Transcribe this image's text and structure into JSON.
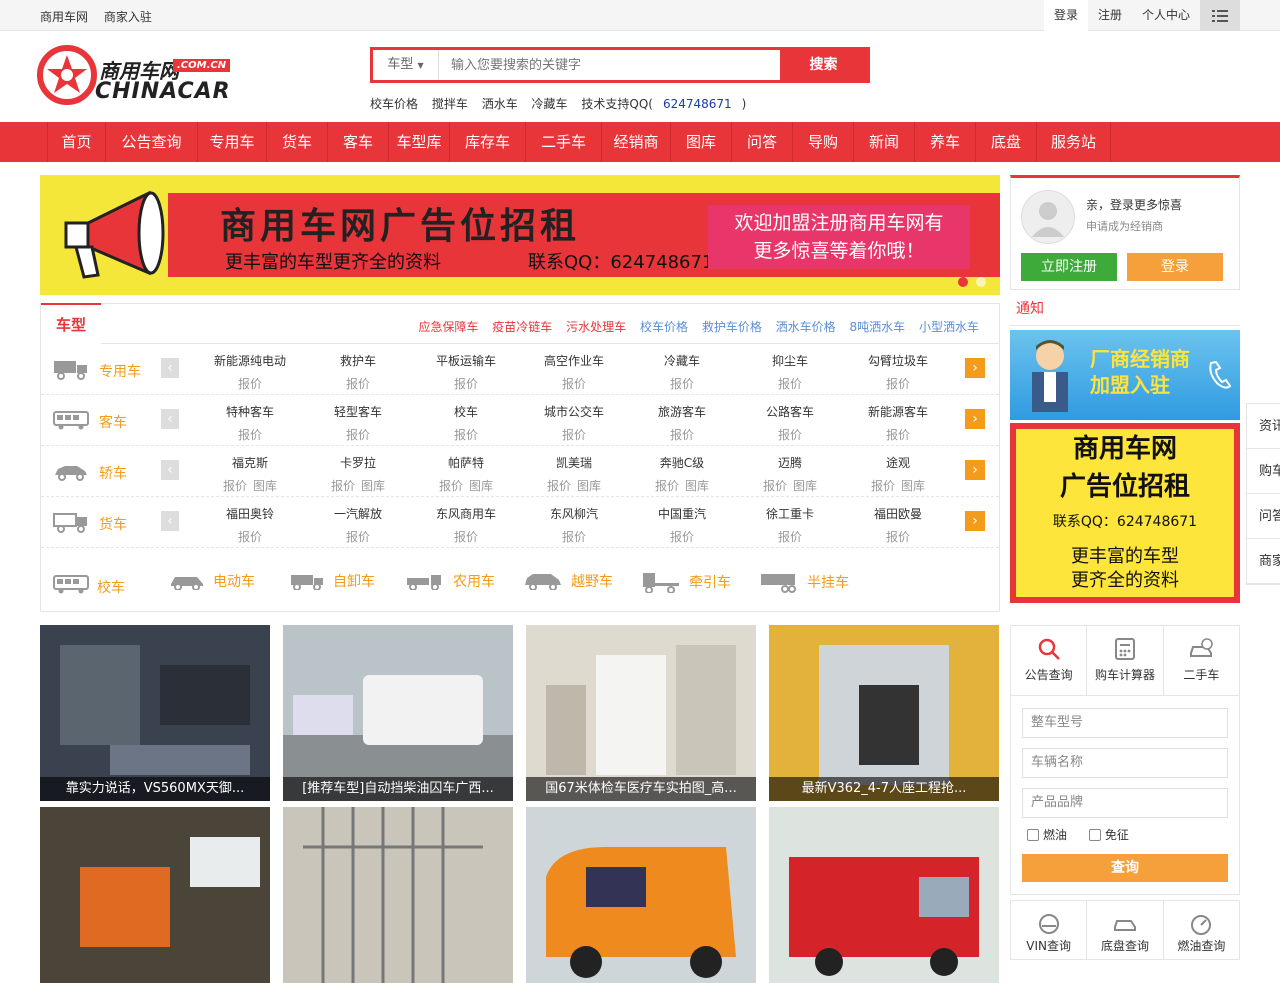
{
  "topbar": {
    "links": [
      "商用车网",
      "商家入驻"
    ],
    "login": "登录",
    "register": "注册",
    "personal": "个人中心"
  },
  "logo": {
    "cn": "商用车网",
    "badge": ".COM.CN",
    "en": "CHINACAR"
  },
  "search": {
    "type_label": "车型",
    "placeholder": "输入您要搜索的关键字",
    "button": "搜索"
  },
  "hotwords": [
    "校车价格",
    "搅拌车",
    "洒水车",
    "冷藏车"
  ],
  "support": {
    "label": "技术支持QQ(",
    "qq": "624748671",
    "close": ")"
  },
  "nav": [
    "首页",
    "公告查询",
    "专用车",
    "货车",
    "客车",
    "车型库",
    "库存车",
    "二手车",
    "经销商",
    "图库",
    "问答",
    "导购",
    "新闻",
    "养车",
    "底盘",
    "服务站"
  ],
  "banner": {
    "headline": "商用车网广告位招租",
    "sub1": "更丰富的车型更齐全的资料",
    "sub2": "联系QQ：624748671",
    "pink1": "欢迎加盟注册商用车网有",
    "pink2": "更多惊喜等着你哦！"
  },
  "category": {
    "tab": "车型",
    "links": [
      {
        "text": "应急保障车",
        "color": "#e8353a"
      },
      {
        "text": "疫苗冷链车",
        "color": "#e8353a"
      },
      {
        "text": "污水处理车",
        "color": "#e8353a"
      },
      {
        "text": "校车价格",
        "color": "#5b8ed6"
      },
      {
        "text": "救护车价格",
        "color": "#5b8ed6"
      },
      {
        "text": "洒水车价格",
        "color": "#5b8ed6"
      },
      {
        "text": "8吨洒水车",
        "color": "#5b8ed6"
      },
      {
        "text": "小型洒水车",
        "color": "#5b8ed6"
      }
    ],
    "rows": [
      {
        "name": "专用车",
        "items": [
          {
            "n": "新能源纯电动",
            "p": [
              "报价"
            ]
          },
          {
            "n": "救护车",
            "p": [
              "报价"
            ]
          },
          {
            "n": "平板运输车",
            "p": [
              "报价"
            ]
          },
          {
            "n": "高空作业车",
            "p": [
              "报价"
            ]
          },
          {
            "n": "冷藏车",
            "p": [
              "报价"
            ]
          },
          {
            "n": "抑尘车",
            "p": [
              "报价"
            ]
          },
          {
            "n": "勾臂垃圾车",
            "p": [
              "报价"
            ]
          }
        ]
      },
      {
        "name": "客车",
        "items": [
          {
            "n": "特种客车",
            "p": [
              "报价"
            ]
          },
          {
            "n": "轻型客车",
            "p": [
              "报价"
            ]
          },
          {
            "n": "校车",
            "p": [
              "报价"
            ]
          },
          {
            "n": "城市公交车",
            "p": [
              "报价"
            ]
          },
          {
            "n": "旅游客车",
            "p": [
              "报价"
            ]
          },
          {
            "n": "公路客车",
            "p": [
              "报价"
            ]
          },
          {
            "n": "新能源客车",
            "p": [
              "报价"
            ]
          }
        ]
      },
      {
        "name": "轿车",
        "items": [
          {
            "n": "福克斯",
            "p": [
              "报价",
              "图库"
            ]
          },
          {
            "n": "卡罗拉",
            "p": [
              "报价",
              "图库"
            ]
          },
          {
            "n": "帕萨特",
            "p": [
              "报价",
              "图库"
            ]
          },
          {
            "n": "凯美瑞",
            "p": [
              "报价",
              "图库"
            ]
          },
          {
            "n": "奔驰C级",
            "p": [
              "报价",
              "图库"
            ]
          },
          {
            "n": "迈腾",
            "p": [
              "报价",
              "图库"
            ]
          },
          {
            "n": "途观",
            "p": [
              "报价",
              "图库"
            ]
          }
        ]
      },
      {
        "name": "货车",
        "items": [
          {
            "n": "福田奥铃",
            "p": [
              "报价"
            ]
          },
          {
            "n": "一汽解放",
            "p": [
              "报价"
            ]
          },
          {
            "n": "东风商用车",
            "p": [
              "报价"
            ]
          },
          {
            "n": "东风柳汽",
            "p": [
              "报价"
            ]
          },
          {
            "n": "中国重汽",
            "p": [
              "报价"
            ]
          },
          {
            "n": "徐工重卡",
            "p": [
              "报价"
            ]
          },
          {
            "n": "福田欧曼",
            "p": [
              "报价"
            ]
          }
        ]
      }
    ],
    "bottom": [
      "校车",
      "电动车",
      "自卸车",
      "农用车",
      "越野车",
      "牵引车",
      "半挂车"
    ]
  },
  "photos": [
    {
      "cap": "靠实力说话，VS560MX天御...",
      "bg": "#3a4250"
    },
    {
      "cap": "[推荐车型]自动挡柴油囚车广西...",
      "bg": "#9aa2a6"
    },
    {
      "cap": "国67米体检车医疗车实拍图_高...",
      "bg": "#d4d2c8"
    },
    {
      "cap": "最新V362_4-7人座工程抢...",
      "bg": "#c8a23a"
    },
    {
      "cap": "",
      "bg": "#4a4538"
    },
    {
      "cap": "",
      "bg": "#b8b4aa"
    },
    {
      "cap": "",
      "bg": "#e08a2a"
    },
    {
      "cap": "",
      "bg": "#c8cfc8"
    }
  ],
  "user": {
    "greeting": "亲，登录更多惊喜",
    "dealer": "申请成为经销商",
    "register": "立即注册",
    "login": "登录"
  },
  "notice": "通知",
  "ad1": {
    "line1": "厂商经销商",
    "line2": "加盟入驻"
  },
  "ad2": {
    "h1": "商用车网",
    "h2": "广告位招租",
    "qq": "联系QQ：624748671",
    "m1": "更丰富的车型",
    "m2": "更齐全的资料"
  },
  "tools": {
    "tabs": [
      "公告查询",
      "购车计算器",
      "二手车"
    ],
    "fields": [
      "整车型号",
      "车辆名称",
      "产品品牌"
    ],
    "checks": [
      "燃油",
      "免征"
    ],
    "submit": "查询",
    "bottom": [
      "VIN查询",
      "底盘查询",
      "燃油查询"
    ]
  },
  "side": [
    "资讯",
    "购车",
    "问答",
    "商家"
  ]
}
